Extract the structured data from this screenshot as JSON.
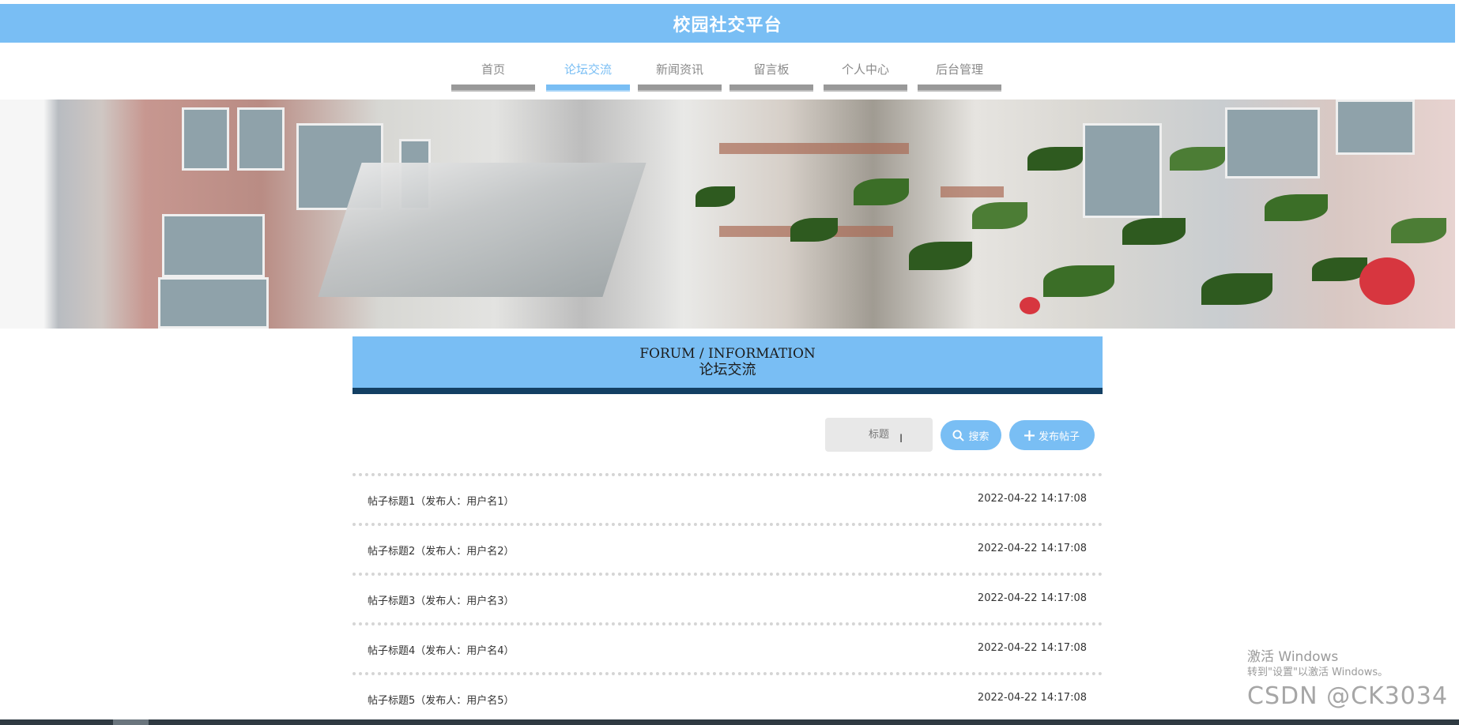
{
  "header": {
    "site_title": "校园社交平台"
  },
  "nav": {
    "items": [
      {
        "label": "首页",
        "active": false
      },
      {
        "label": "论坛交流",
        "active": true
      },
      {
        "label": "新闻资讯",
        "active": false
      },
      {
        "label": "留言板",
        "active": false
      },
      {
        "label": "个人中心",
        "active": false
      },
      {
        "label": "后台管理",
        "active": false
      }
    ]
  },
  "section": {
    "title_en": "FORUM / INFORMATION",
    "title_cn": "论坛交流"
  },
  "search": {
    "placeholder": "标题",
    "search_label": "搜索",
    "publish_label": "发布帖子"
  },
  "posts": [
    {
      "title": "帖子标题1（发布人：用户名1）",
      "time": "2022-04-22 14:17:08"
    },
    {
      "title": "帖子标题2（发布人：用户名2）",
      "time": "2022-04-22 14:17:08"
    },
    {
      "title": "帖子标题3（发布人：用户名3）",
      "time": "2022-04-22 14:17:08"
    },
    {
      "title": "帖子标题4（发布人：用户名4）",
      "time": "2022-04-22 14:17:08"
    },
    {
      "title": "帖子标题5（发布人：用户名5）",
      "time": "2022-04-22 14:17:08"
    }
  ],
  "watermark": {
    "activate_line1": "激活 Windows",
    "activate_line2": "转到\"设置\"以激活 Windows。",
    "csdn": "CSDN @CK3034"
  },
  "colors": {
    "primary": "#79bef4",
    "accent_dark": "#133f63",
    "nav_bar": "#999999"
  },
  "icons": {
    "search": "search-icon",
    "add": "plus-icon"
  }
}
